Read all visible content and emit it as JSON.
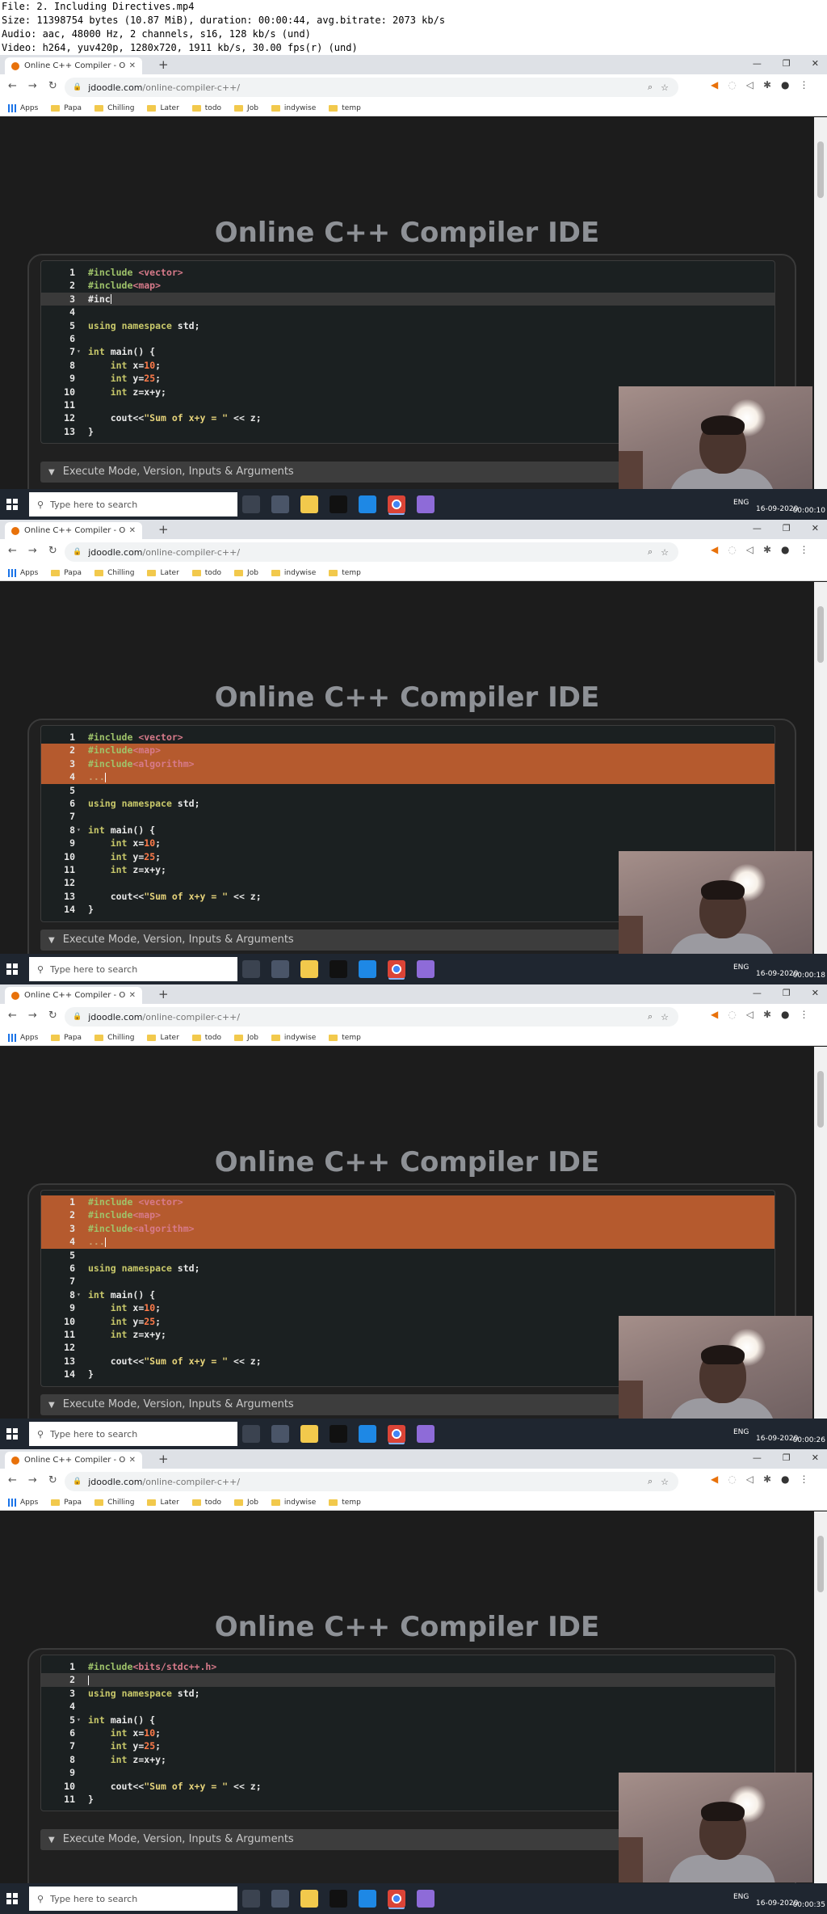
{
  "info": [
    "File: 2. Including Directives.mp4",
    "Size: 11398754 bytes (10.87 MiB), duration: 00:00:44, avg.bitrate: 2073 kb/s",
    "Audio: aac, 48000 Hz, 2 channels, s16, 128 kb/s (und)",
    "Video: h264, yuv420p, 1280x720, 1911 kb/s, 30.00 fps(r) (und)"
  ],
  "browser": {
    "tab_title": "Online C++ Compiler - Online C",
    "url_domain": "jdoodle.com",
    "url_path": "/online-compiler-c++/",
    "bookmarks": [
      "Apps",
      "Papa",
      "Chilling",
      "Later",
      "todo",
      "Job",
      "indywise",
      "temp"
    ]
  },
  "page": {
    "title": "Online C++ Compiler IDE",
    "exec_label": "Execute Mode, Version, Inputs & Arguments"
  },
  "taskbar": {
    "search_placeholder": "Type here to search",
    "lang": "ENG",
    "date": "16-09-2020"
  },
  "frames": [
    {
      "timestamp": "00:00:10",
      "lines": [
        {
          "n": "1",
          "fold": "",
          "code": "#include <vector>"
        },
        {
          "n": "2",
          "fold": "",
          "code": "#include<map>"
        },
        {
          "n": "3",
          "fold": "",
          "code": "#inc"
        },
        {
          "n": "4",
          "fold": "",
          "code": ""
        },
        {
          "n": "5",
          "fold": "",
          "code": "using namespace std;"
        },
        {
          "n": "6",
          "fold": "",
          "code": ""
        },
        {
          "n": "7",
          "fold": "▾",
          "code": "int main() {"
        },
        {
          "n": "8",
          "fold": "",
          "code": "    int x=10;"
        },
        {
          "n": "9",
          "fold": "",
          "code": "    int y=25;"
        },
        {
          "n": "10",
          "fold": "",
          "code": "    int z=x+y;"
        },
        {
          "n": "11",
          "fold": "",
          "code": ""
        },
        {
          "n": "12",
          "fold": "",
          "code": "    cout<<\"Sum of x+y = \" << z;"
        },
        {
          "n": "13",
          "fold": "",
          "code": "}"
        }
      ]
    },
    {
      "timestamp": "00:00:18",
      "lines": [
        {
          "n": "1",
          "fold": "",
          "code": "#include <vector>"
        },
        {
          "n": "2",
          "fold": "",
          "code": "#include<map>"
        },
        {
          "n": "3",
          "fold": "",
          "code": "#include<algorithm>"
        },
        {
          "n": "4",
          "fold": "",
          "code": "..."
        },
        {
          "n": "5",
          "fold": "",
          "code": ""
        },
        {
          "n": "6",
          "fold": "",
          "code": "using namespace std;"
        },
        {
          "n": "7",
          "fold": "",
          "code": ""
        },
        {
          "n": "8",
          "fold": "▾",
          "code": "int main() {"
        },
        {
          "n": "9",
          "fold": "",
          "code": "    int x=10;"
        },
        {
          "n": "10",
          "fold": "",
          "code": "    int y=25;"
        },
        {
          "n": "11",
          "fold": "",
          "code": "    int z=x+y;"
        },
        {
          "n": "12",
          "fold": "",
          "code": ""
        },
        {
          "n": "13",
          "fold": "",
          "code": "    cout<<\"Sum of x+y = \" << z;"
        },
        {
          "n": "14",
          "fold": "",
          "code": "}"
        }
      ]
    },
    {
      "timestamp": "00:00:26",
      "lines": [
        {
          "n": "1",
          "fold": "",
          "code": "#include <vector>"
        },
        {
          "n": "2",
          "fold": "",
          "code": "#include<map>"
        },
        {
          "n": "3",
          "fold": "",
          "code": "#include<algorithm>"
        },
        {
          "n": "4",
          "fold": "",
          "code": "..."
        },
        {
          "n": "5",
          "fold": "",
          "code": ""
        },
        {
          "n": "6",
          "fold": "",
          "code": "using namespace std;"
        },
        {
          "n": "7",
          "fold": "",
          "code": ""
        },
        {
          "n": "8",
          "fold": "▾",
          "code": "int main() {"
        },
        {
          "n": "9",
          "fold": "",
          "code": "    int x=10;"
        },
        {
          "n": "10",
          "fold": "",
          "code": "    int y=25;"
        },
        {
          "n": "11",
          "fold": "",
          "code": "    int z=x+y;"
        },
        {
          "n": "12",
          "fold": "",
          "code": ""
        },
        {
          "n": "13",
          "fold": "",
          "code": "    cout<<\"Sum of x+y = \" << z;"
        },
        {
          "n": "14",
          "fold": "",
          "code": "}"
        }
      ]
    },
    {
      "timestamp": "00:00:35",
      "lines": [
        {
          "n": "1",
          "fold": "",
          "code": "#include<bits/stdc++.h>"
        },
        {
          "n": "2",
          "fold": "",
          "code": ""
        },
        {
          "n": "3",
          "fold": "",
          "code": "using namespace std;"
        },
        {
          "n": "4",
          "fold": "",
          "code": ""
        },
        {
          "n": "5",
          "fold": "▾",
          "code": "int main() {"
        },
        {
          "n": "6",
          "fold": "",
          "code": "    int x=10;"
        },
        {
          "n": "7",
          "fold": "",
          "code": "    int y=25;"
        },
        {
          "n": "8",
          "fold": "",
          "code": "    int z=x+y;"
        },
        {
          "n": "9",
          "fold": "",
          "code": ""
        },
        {
          "n": "10",
          "fold": "",
          "code": "    cout<<\"Sum of x+y = \" << z;"
        },
        {
          "n": "11",
          "fold": "",
          "code": "}"
        }
      ]
    }
  ]
}
